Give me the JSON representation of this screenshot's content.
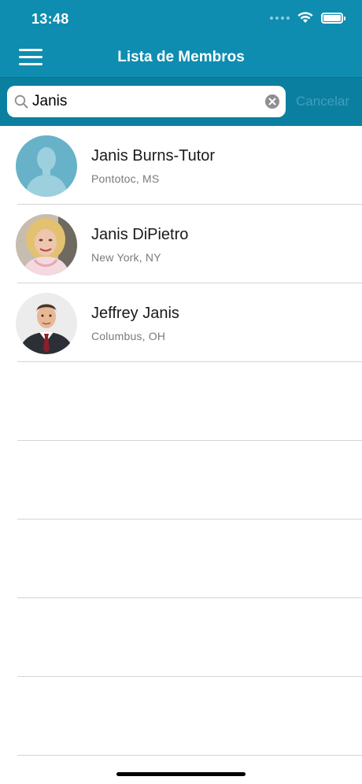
{
  "status_bar": {
    "time": "13:48"
  },
  "nav": {
    "title": "Lista de Membros",
    "menu_icon": "hamburger-menu-icon"
  },
  "search": {
    "value": "Janis",
    "cancel_label": "Cancelar"
  },
  "members": [
    {
      "name": "Janis Burns-Tutor",
      "location": "Pontotoc, MS",
      "avatar": "placeholder-silhouette"
    },
    {
      "name": "Janis DiPietro",
      "location": "New York, NY",
      "avatar": "photo-blonde-woman"
    },
    {
      "name": "Jeffrey Janis",
      "location": "Columbus, OH",
      "avatar": "photo-man-in-suit"
    }
  ],
  "colors": {
    "header": "#0e8db0",
    "search_bar": "#0b7f9f",
    "cancel": "#3f9fbe"
  }
}
